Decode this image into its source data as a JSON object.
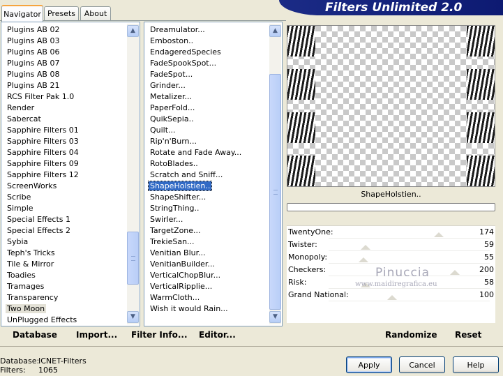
{
  "tabs": [
    {
      "label": "Navigator",
      "active": true
    },
    {
      "label": "Presets",
      "active": false
    },
    {
      "label": "About",
      "active": false
    }
  ],
  "app_title": "Filters Unlimited 2.0",
  "categories": [
    "Plugins AB 02",
    "Plugins AB 03",
    "Plugins AB 06",
    "Plugins AB 07",
    "Plugins AB 08",
    "Plugins AB 21",
    "RCS Filter Pak 1.0",
    "Render",
    "Sabercat",
    "Sapphire Filters 01",
    "Sapphire Filters 03",
    "Sapphire Filters 04",
    "Sapphire Filters 09",
    "Sapphire Filters 12",
    "ScreenWorks",
    "Scribe",
    "Simple",
    "Special Effects 1",
    "Special Effects 2",
    "Sybia",
    "Teph's Tricks",
    "Tile & Mirror",
    "Toadies",
    "Tramages",
    "Transparency",
    "Two Moon",
    "UnPlugged Effects"
  ],
  "selected_category": "Two Moon",
  "filters": [
    "Dreamulator...",
    "Emboston..",
    "EndageredSpecies",
    "FadeSpookSpot...",
    "FadeSpot...",
    "Grinder...",
    "Metalizer...",
    "PaperFold...",
    "QuikSepia..",
    "Quilt...",
    "Rip'n'Burn...",
    "Rotate and Fade Away...",
    "RotoBlades..",
    "Scratch and Sniff...",
    "ShapeHolstien..",
    "ShapeShifter...",
    "StringThing..",
    "Swirler...",
    "TargetZone...",
    "TrekieSan...",
    "Venitian Blur...",
    "VenitianBuilder...",
    "VerticalChopBlur...",
    "VerticalRipplie...",
    "WarmCloth...",
    "Wish it would Rain..."
  ],
  "selected_filter": "ShapeHolstien..",
  "preview_filter_name": "ShapeHolstien..",
  "params": [
    {
      "label": "TwentyOne:",
      "value": "174"
    },
    {
      "label": "Twister:",
      "value": "59"
    },
    {
      "label": "Monopoly:",
      "value": "55"
    },
    {
      "label": "Checkers:",
      "value": "200"
    },
    {
      "label": "Risk:",
      "value": "58"
    },
    {
      "label": "Grand National:",
      "value": "100"
    }
  ],
  "param_levels_of_255": [
    174,
    59,
    55,
    200,
    58,
    100
  ],
  "watermark": {
    "name": "Pinuccia",
    "url": "www.maidiregrafica.eu"
  },
  "links": {
    "database": "Database",
    "import": "Import...",
    "filter_info": "Filter Info...",
    "editor": "Editor...",
    "randomize": "Randomize",
    "reset": "Reset"
  },
  "status": {
    "database_label": "Database:",
    "database_value": "ICNET-Filters",
    "filters_label": "Filters:",
    "filters_value": "1065"
  },
  "buttons": {
    "apply": "Apply",
    "cancel": "Cancel",
    "help": "Help"
  },
  "colors": {
    "title_bg": "#0d1a72",
    "selection": "#316ac5",
    "window_bg": "#ece9d8"
  }
}
